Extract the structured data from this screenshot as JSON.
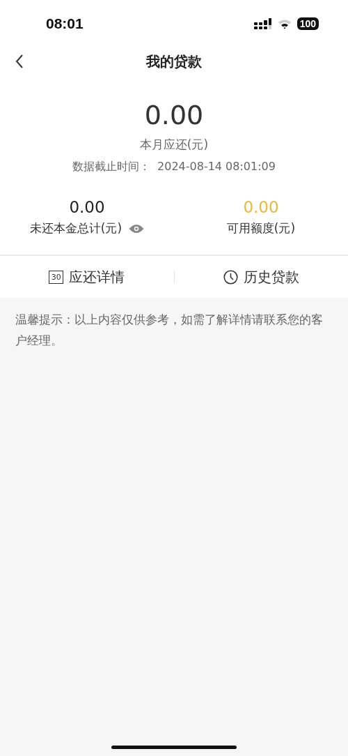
{
  "status_bar": {
    "time": "08:01",
    "battery": "100"
  },
  "nav": {
    "title": "我的贷款"
  },
  "summary": {
    "amount": "0.00",
    "label": "本月应还(元)",
    "as_of_label": "数据截止时间：",
    "as_of_value": "2024-08-14 08:01:09"
  },
  "stats": [
    {
      "value": "0.00",
      "label": "未还本金总计(元)",
      "kind": "principal"
    },
    {
      "value": "0.00",
      "label": "可用额度(元)",
      "kind": "credit"
    }
  ],
  "actions": [
    {
      "label": "应还详情",
      "kind": "calendar",
      "icon_text": "30"
    },
    {
      "label": "历史贷款",
      "kind": "history"
    }
  ],
  "notice": "温馨提示：以上内容仅供参考，如需了解详情请联系您的客户经理。"
}
